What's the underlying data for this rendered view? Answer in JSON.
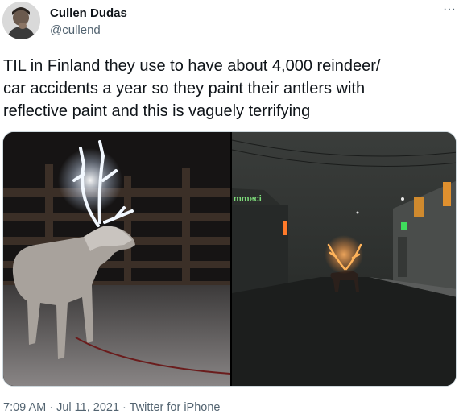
{
  "author": {
    "display_name": "Cullen Dudas",
    "handle": "@cullend"
  },
  "more_icon": "more-horizontal-icon",
  "tweet": {
    "text": "TIL in Finland they use to have about 4,000 reindeer/\ncar accidents a year so they paint their antlers with\nreflective paint and this is vaguely terrifying"
  },
  "media": {
    "right_sign_text": "mmeci"
  },
  "meta": {
    "time": "7:09 AM",
    "sep1": " · ",
    "date": "Jul 11, 2021",
    "sep2": " · ",
    "source": "Twitter for iPhone"
  },
  "colors": {
    "text_primary": "#0f1419",
    "text_secondary": "#536471",
    "antler_glow_white": "#e8f2ff",
    "antler_glow_orange": "#ff9a3c"
  }
}
